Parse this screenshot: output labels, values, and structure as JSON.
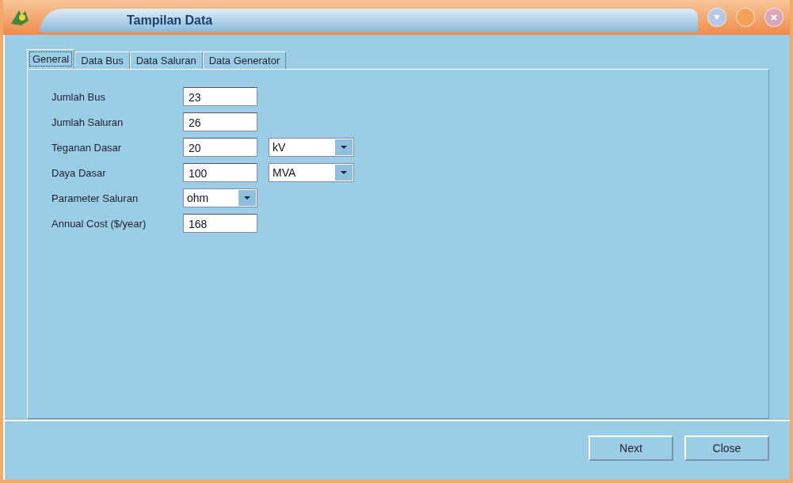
{
  "window": {
    "title": "Tampilan Data"
  },
  "tabs": [
    {
      "label": "General",
      "selected": true
    },
    {
      "label": "Data Bus",
      "selected": false
    },
    {
      "label": "Data Saluran",
      "selected": false
    },
    {
      "label": "Data Generator",
      "selected": false
    }
  ],
  "form": [
    {
      "kind": "input",
      "label": "Jumlah Bus",
      "value": "23"
    },
    {
      "kind": "input_unit",
      "label": "Jumlah Saluran",
      "value": "26"
    },
    {
      "kind": "input_unit",
      "label": "Teganan Dasar",
      "value": "20",
      "unit": "kV"
    },
    {
      "kind": "input_unit",
      "label": "Daya Dasar",
      "value": "100",
      "unit": "MVA"
    },
    {
      "kind": "select",
      "label": "Parameter Saluran",
      "value": "ohm"
    },
    {
      "kind": "input",
      "label": "Annual Cost ($/year)",
      "value": "168"
    }
  ],
  "buttons": [
    {
      "label": "Next"
    },
    {
      "label": "Close"
    }
  ]
}
